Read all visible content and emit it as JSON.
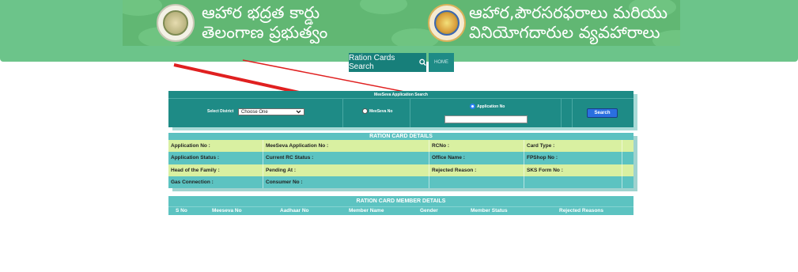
{
  "header": {
    "left_title_line1": "ఆహార భద్రత కార్డు",
    "left_title_line2": "తెలంగాణ ప్రభుత్వం",
    "right_title_line1": "ఆహార,పౌరసరఫరాలు మరియు",
    "right_title_line2": "వినియోగదారుల వ్యవహారాలు",
    "left_emblem_icon": "telangana-state-emblem-icon",
    "right_emblem_icon": "civil-supplies-logo-icon"
  },
  "nav": {
    "ration_search_label": "Ration Cards Search",
    "search_icon": "search-icon",
    "home_label": "HOME"
  },
  "search_panel": {
    "heading": "MeeSeva Application Search",
    "district_label": "Select District",
    "district_selected": "Choose One",
    "radio_meeseva_label": "MeeSeva No",
    "radio_application_label": "Application No",
    "selected_option": "Application No",
    "search_button": "Search"
  },
  "details": {
    "title": "RATION CARD DETAILS",
    "rows": [
      [
        "Application No :",
        "MeeSeva Application No :",
        "RCNo :",
        "Card Type :",
        ""
      ],
      [
        "Application Status :",
        "Current RC Status :",
        "Office Name :",
        "FPShop No :",
        ""
      ],
      [
        "Head of the Family :",
        "Pending At :",
        "Rejected Reason :",
        "SKS Form No :",
        ""
      ],
      [
        "Gas Connection :",
        "Consumer No :",
        "",
        "",
        ""
      ]
    ]
  },
  "members": {
    "title": "RATION CARD MEMBER DETAILS",
    "columns": [
      "S No",
      "Meeseva No",
      "Aadhaar No",
      "Member Name",
      "Gender",
      "Member Status",
      "Rejected Reasons"
    ]
  },
  "colors": {
    "header_green": "#6cc48a",
    "panel_teal": "#1e8b86",
    "table_teal": "#5cc3c1",
    "table_light": "#d9f0a1",
    "arrow_red": "#e02020",
    "search_blue": "#2a6fe0"
  }
}
